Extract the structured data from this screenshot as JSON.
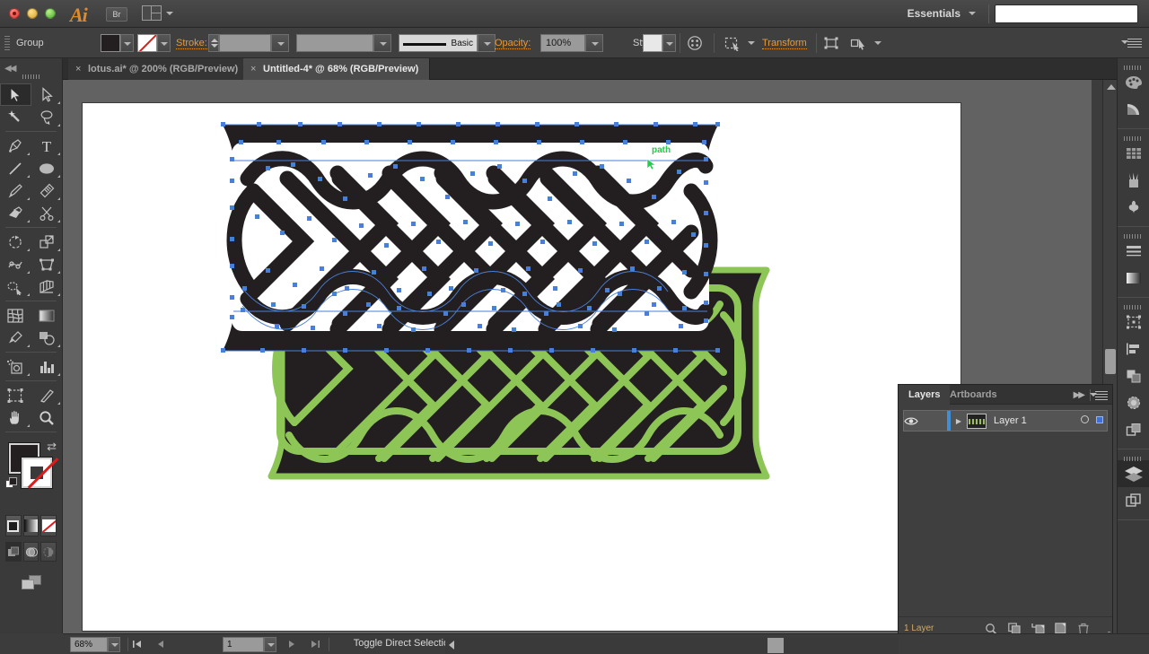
{
  "app": {
    "name": "Adobe Illustrator",
    "logo_text": "Ai",
    "bridge_button": "Br",
    "workspace": "Essentials",
    "search_value": "",
    "search_placeholder": ""
  },
  "control_bar": {
    "selection_type": "Group",
    "fill_label": "Fill",
    "stroke_label": "Stroke:",
    "stroke_weight": "",
    "stroke_profile": "",
    "brush_definition": "Basic",
    "opacity_label": "Opacity:",
    "opacity_value": "100%",
    "style_label": "Style:",
    "transform_label": "Transform",
    "align_icon": "align-icon",
    "select_similar_icon": "select-similar-icon",
    "recolor_icon": "recolor-artwork-icon",
    "panel_menu_icon": "panel-menu-icon"
  },
  "tabs": [
    {
      "title": "lotus.ai* @ 200% (RGB/Preview)",
      "active": false,
      "close_icon": "close-icon"
    },
    {
      "title": "Untitled-4* @ 68% (RGB/Preview)",
      "active": true,
      "close_icon": "close-icon"
    }
  ],
  "tools": {
    "column_left": [
      "selection-tool",
      "magic-wand-tool",
      "pen-tool",
      "line-segment-tool",
      "paintbrush-tool",
      "shape-builder-tool",
      "rotate-tool",
      "width-tool",
      "free-transform-tool",
      "mesh-tool",
      "eyedropper-tool",
      "symbol-sprayer-tool",
      "artboard-tool",
      "hand-tool"
    ],
    "column_right": [
      "direct-selection-tool",
      "lasso-tool",
      "type-tool",
      "ellipse-tool",
      "blob-brush-tool",
      "scissors-tool",
      "scale-tool",
      "shape-perspective-tool",
      "graph-tool-left",
      "gradient-tool",
      "blend-tool",
      "column-graph-tool",
      "slice-tool",
      "zoom-tool"
    ],
    "active_tool": "selection-tool",
    "fill_color": "#231f20",
    "stroke_color": "none",
    "swap_icon": "swap-fill-stroke-icon",
    "default_icon": "default-fill-stroke-icon",
    "color_modes": [
      "color-mode-solid",
      "color-mode-gradient",
      "color-mode-none"
    ],
    "draw_modes": [
      "draw-normal",
      "draw-behind",
      "draw-inside"
    ],
    "screen_mode": "change-screen-mode"
  },
  "canvas": {
    "artboard_background": "#ffffff",
    "smart_guide_label": "path",
    "smart_guide_color": "#22cc4e",
    "selection_color": "#4a7fd8",
    "artwork": [
      {
        "name": "celtic-knot-band-selected",
        "fill": "#231f20",
        "stroke": "none",
        "selected": true,
        "description": "Celtic interlace braid band, dark fill, path anchors visible"
      },
      {
        "name": "celtic-knot-band-green",
        "fill": "#231f20",
        "stroke": "#8dc556",
        "selected": false,
        "description": "Celtic interlace knot panel, dark fill with green outline strokes"
      }
    ]
  },
  "status_bar": {
    "zoom_level": "68%",
    "artboard_number": "1",
    "status_text": "Toggle Direct Selection",
    "first_icon": "first-artboard-icon",
    "prev_icon": "previous-artboard-icon",
    "next_icon": "next-artboard-icon",
    "last_icon": "last-artboard-icon"
  },
  "icon_dock": {
    "groups": [
      [
        "color-panel-icon",
        "color-guide-icon"
      ],
      [
        "swatches-panel-icon",
        "brushes-panel-icon",
        "symbols-panel-icon"
      ],
      [
        "stroke-panel-icon",
        "gradient-panel-icon"
      ],
      [
        "transform-panel-icon",
        "align-panel-icon",
        "pathfinder-panel-icon",
        "transparency-panel-icon",
        "appearance-panel-icon"
      ],
      [
        "layers-panel-icon",
        "artboards-panel-icon"
      ]
    ],
    "active": "layers-panel-icon"
  },
  "layers_panel": {
    "tabs": [
      {
        "label": "Layers",
        "active": true
      },
      {
        "label": "Artboards",
        "active": false
      }
    ],
    "rows": [
      {
        "name": "Layer 1",
        "visible": true,
        "locked": false,
        "expanded": false,
        "color": "#3f8fd8",
        "selected": true,
        "eye_icon": "eye-icon",
        "disclosure_icon": "chevron-right-icon",
        "thumbnail_icon": "layer-thumbnail"
      }
    ],
    "footer": {
      "count_text": "1 Layer",
      "icons": [
        "locate-object-icon",
        "make-clipping-mask-icon",
        "create-new-sublayer-icon",
        "create-new-layer-icon",
        "delete-selection-icon"
      ]
    },
    "collapse_icon": "expand-panels-icon",
    "menu_icon": "panel-menu-icon"
  }
}
